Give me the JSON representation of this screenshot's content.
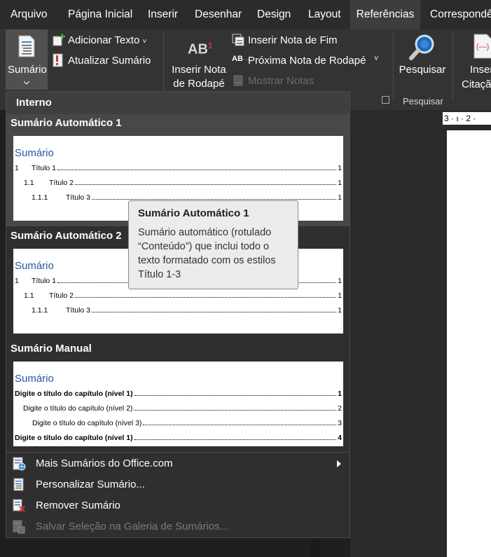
{
  "menu": {
    "tabs": [
      "Arquivo",
      "Página Inicial",
      "Inserir",
      "Desenhar",
      "Design",
      "Layout",
      "Referências",
      "Correspondê"
    ],
    "active": "Referências"
  },
  "ribbon": {
    "sumario_label": "Sumário",
    "adicionar_texto": "Adicionar Texto",
    "atualizar_sumario": "Atualizar Sumário",
    "inserir_nota_rodape_line1": "Inserir Nota",
    "inserir_nota_rodape_line2": "de Rodapé",
    "inserir_nota_fim": "Inserir Nota de Fim",
    "proxima_nota": "Próxima Nota de Rodapé",
    "mostrar_notas": "Mostrar Notas",
    "pesquisar": "Pesquisar",
    "pesquisar_group": "Pesquisar",
    "inserir_citacao_line1": "Inser",
    "inserir_citacao_line2": "Citaçã",
    "ab_icon_text": "AB",
    "ab_superscript": "1"
  },
  "ruler_text": "3 · ı · 2 ·",
  "dropdown": {
    "section_interno": "Interno",
    "auto1": {
      "heading": "Sumário Automático 1",
      "preview_title": "Sumário",
      "rows": [
        {
          "num": "1",
          "text": "Título 1",
          "page": "1"
        },
        {
          "num": "1.1",
          "text": "Título 2",
          "page": "1"
        },
        {
          "num": "1.1.1",
          "text": "Título 3",
          "page": "1"
        }
      ]
    },
    "auto2": {
      "heading": "Sumário Automático 2",
      "preview_title": "Sumário",
      "rows": [
        {
          "num": "1",
          "text": "Título 1",
          "page": "1"
        },
        {
          "num": "1.1",
          "text": "Título 2",
          "page": "1"
        },
        {
          "num": "1.1.1",
          "text": "Título 3",
          "page": "1"
        }
      ]
    },
    "manual": {
      "heading": "Sumário Manual",
      "preview_title": "Sumário",
      "rows": [
        {
          "text": "Digite o título do capítulo (nível 1)",
          "page": "1"
        },
        {
          "text": "Digite o título do capítulo (nível 2)",
          "page": "2"
        },
        {
          "text": "Digite o título do capítulo (nível 3)",
          "page": "3"
        },
        {
          "text": "Digite o título do capítulo (nível 1)",
          "page": "4"
        }
      ]
    },
    "commands": {
      "mais": "Mais Sumários do Office.com",
      "personalizar": "Personalizar Sumário...",
      "remover": "Remover Sumário",
      "salvar": "Salvar Seleção na Galeria de Sumários..."
    }
  },
  "tooltip": {
    "title": "Sumário Automático 1",
    "body": "Sumário automático (rotulado “Conteúdo”) que inclui todo o texto formatado com os estilos Título 1-3"
  },
  "colors": {
    "accent_blue": "#2f5496",
    "icon_red": "#d13438",
    "icon_blue": "#3a86d6"
  }
}
